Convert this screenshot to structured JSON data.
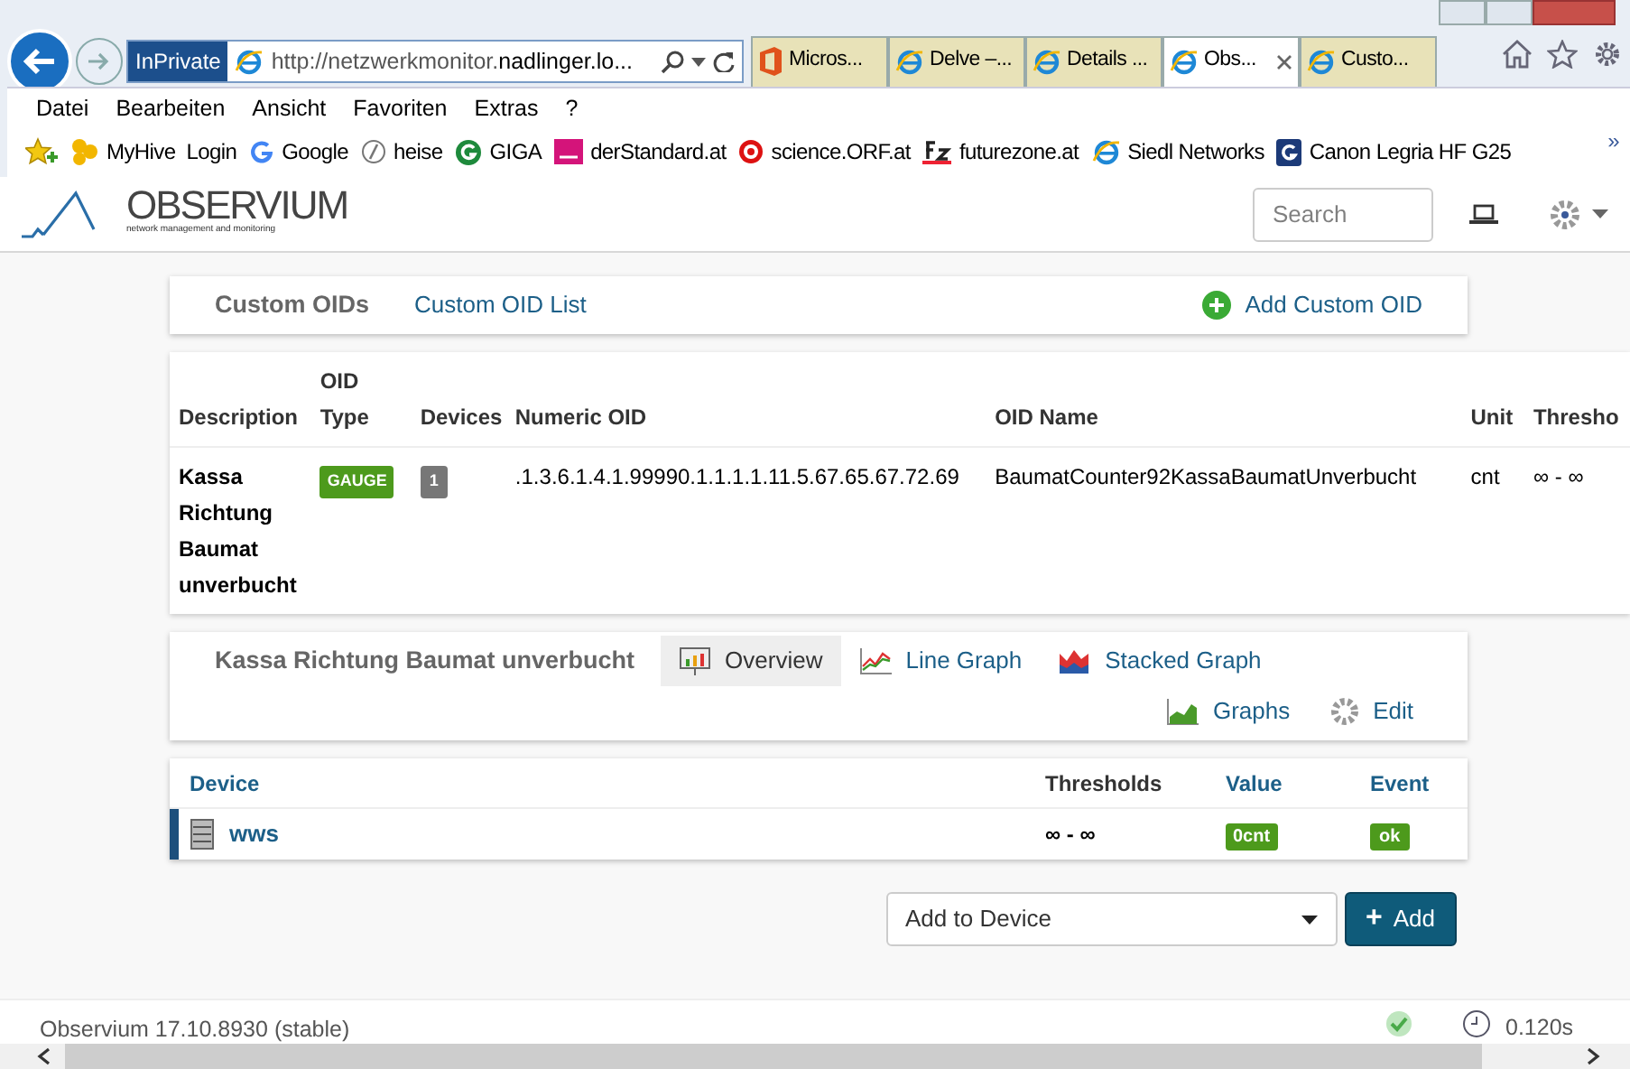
{
  "browser": {
    "inprivate": "InPrivate",
    "url_prefix": "http://netzwerkmonitor.",
    "url_host": "nadlinger.lo...",
    "tabs": [
      {
        "label": "Micros...",
        "kind": "office",
        "selected": false
      },
      {
        "label": "Delve –...",
        "kind": "ie",
        "selected": false
      },
      {
        "label": "Details ...",
        "kind": "ie",
        "selected": false
      },
      {
        "label": "Obs...",
        "kind": "ie",
        "selected": true
      },
      {
        "label": "Custo...",
        "kind": "ie",
        "selected": false
      }
    ],
    "menu": [
      "Datei",
      "Bearbeiten",
      "Ansicht",
      "Favoriten",
      "Extras",
      "?"
    ],
    "favorites": [
      {
        "label": "MyHive  Login",
        "kind": "hive"
      },
      {
        "label": "Google",
        "kind": "google"
      },
      {
        "label": "heise",
        "kind": "heise"
      },
      {
        "label": "GIGA",
        "kind": "giga"
      },
      {
        "label": "derStandard.at",
        "kind": "dst"
      },
      {
        "label": "science.ORF.at",
        "kind": "orf"
      },
      {
        "label": "futurezone.at",
        "kind": "fz"
      },
      {
        "label": "Siedl Networks",
        "kind": "ie"
      },
      {
        "label": "Canon Legria HF G25",
        "kind": "g"
      }
    ],
    "more": "»"
  },
  "navbar": {
    "logo": "OBSERVIUM",
    "tagline": "network management and monitoring",
    "search": {
      "placeholder": "Search"
    }
  },
  "header": {
    "title": "Custom OIDs",
    "link": "Custom OID List",
    "button": "Add Custom OID"
  },
  "oid_table": {
    "columns": [
      "Description",
      "OID\nType",
      "Devices",
      "Numeric OID",
      "OID Name",
      "Unit",
      "Thresho"
    ],
    "rows": [
      {
        "description": "Kassa Richtung Baumat unverbucht",
        "type": "GAUGE",
        "devices": "1",
        "numeric_oid": ".1.3.6.1.4.1.99990.1.1.1.1.11.5.67.65.67.72.69",
        "oid_name": "BaumatCounter92KassaBaumatUnverbucht",
        "unit": "cnt",
        "thresholds": "∞ - ∞"
      }
    ]
  },
  "oid_nav": {
    "title": "Kassa Richtung Baumat unverbucht",
    "items": [
      {
        "label": "Overview",
        "kind": "overview",
        "selected": true
      },
      {
        "label": "Line Graph",
        "kind": "line",
        "selected": false
      },
      {
        "label": "Stacked Graph",
        "kind": "stacked",
        "selected": false
      },
      {
        "label": "Graphs",
        "kind": "graphs",
        "selected": false
      },
      {
        "label": "Edit",
        "kind": "edit",
        "selected": false
      }
    ]
  },
  "device_table": {
    "columns": [
      "Device",
      "Thresholds",
      "Value",
      "Event"
    ],
    "rows": [
      {
        "device": "wws",
        "thresholds": "∞ - ∞",
        "value": "0cnt",
        "event": "ok"
      }
    ]
  },
  "add_form": {
    "select": "Add to Device",
    "button": "Add",
    "button_icon": "+"
  },
  "footer": {
    "version": "Observium 17.10.8930 (stable)",
    "time": "0.120s"
  }
}
